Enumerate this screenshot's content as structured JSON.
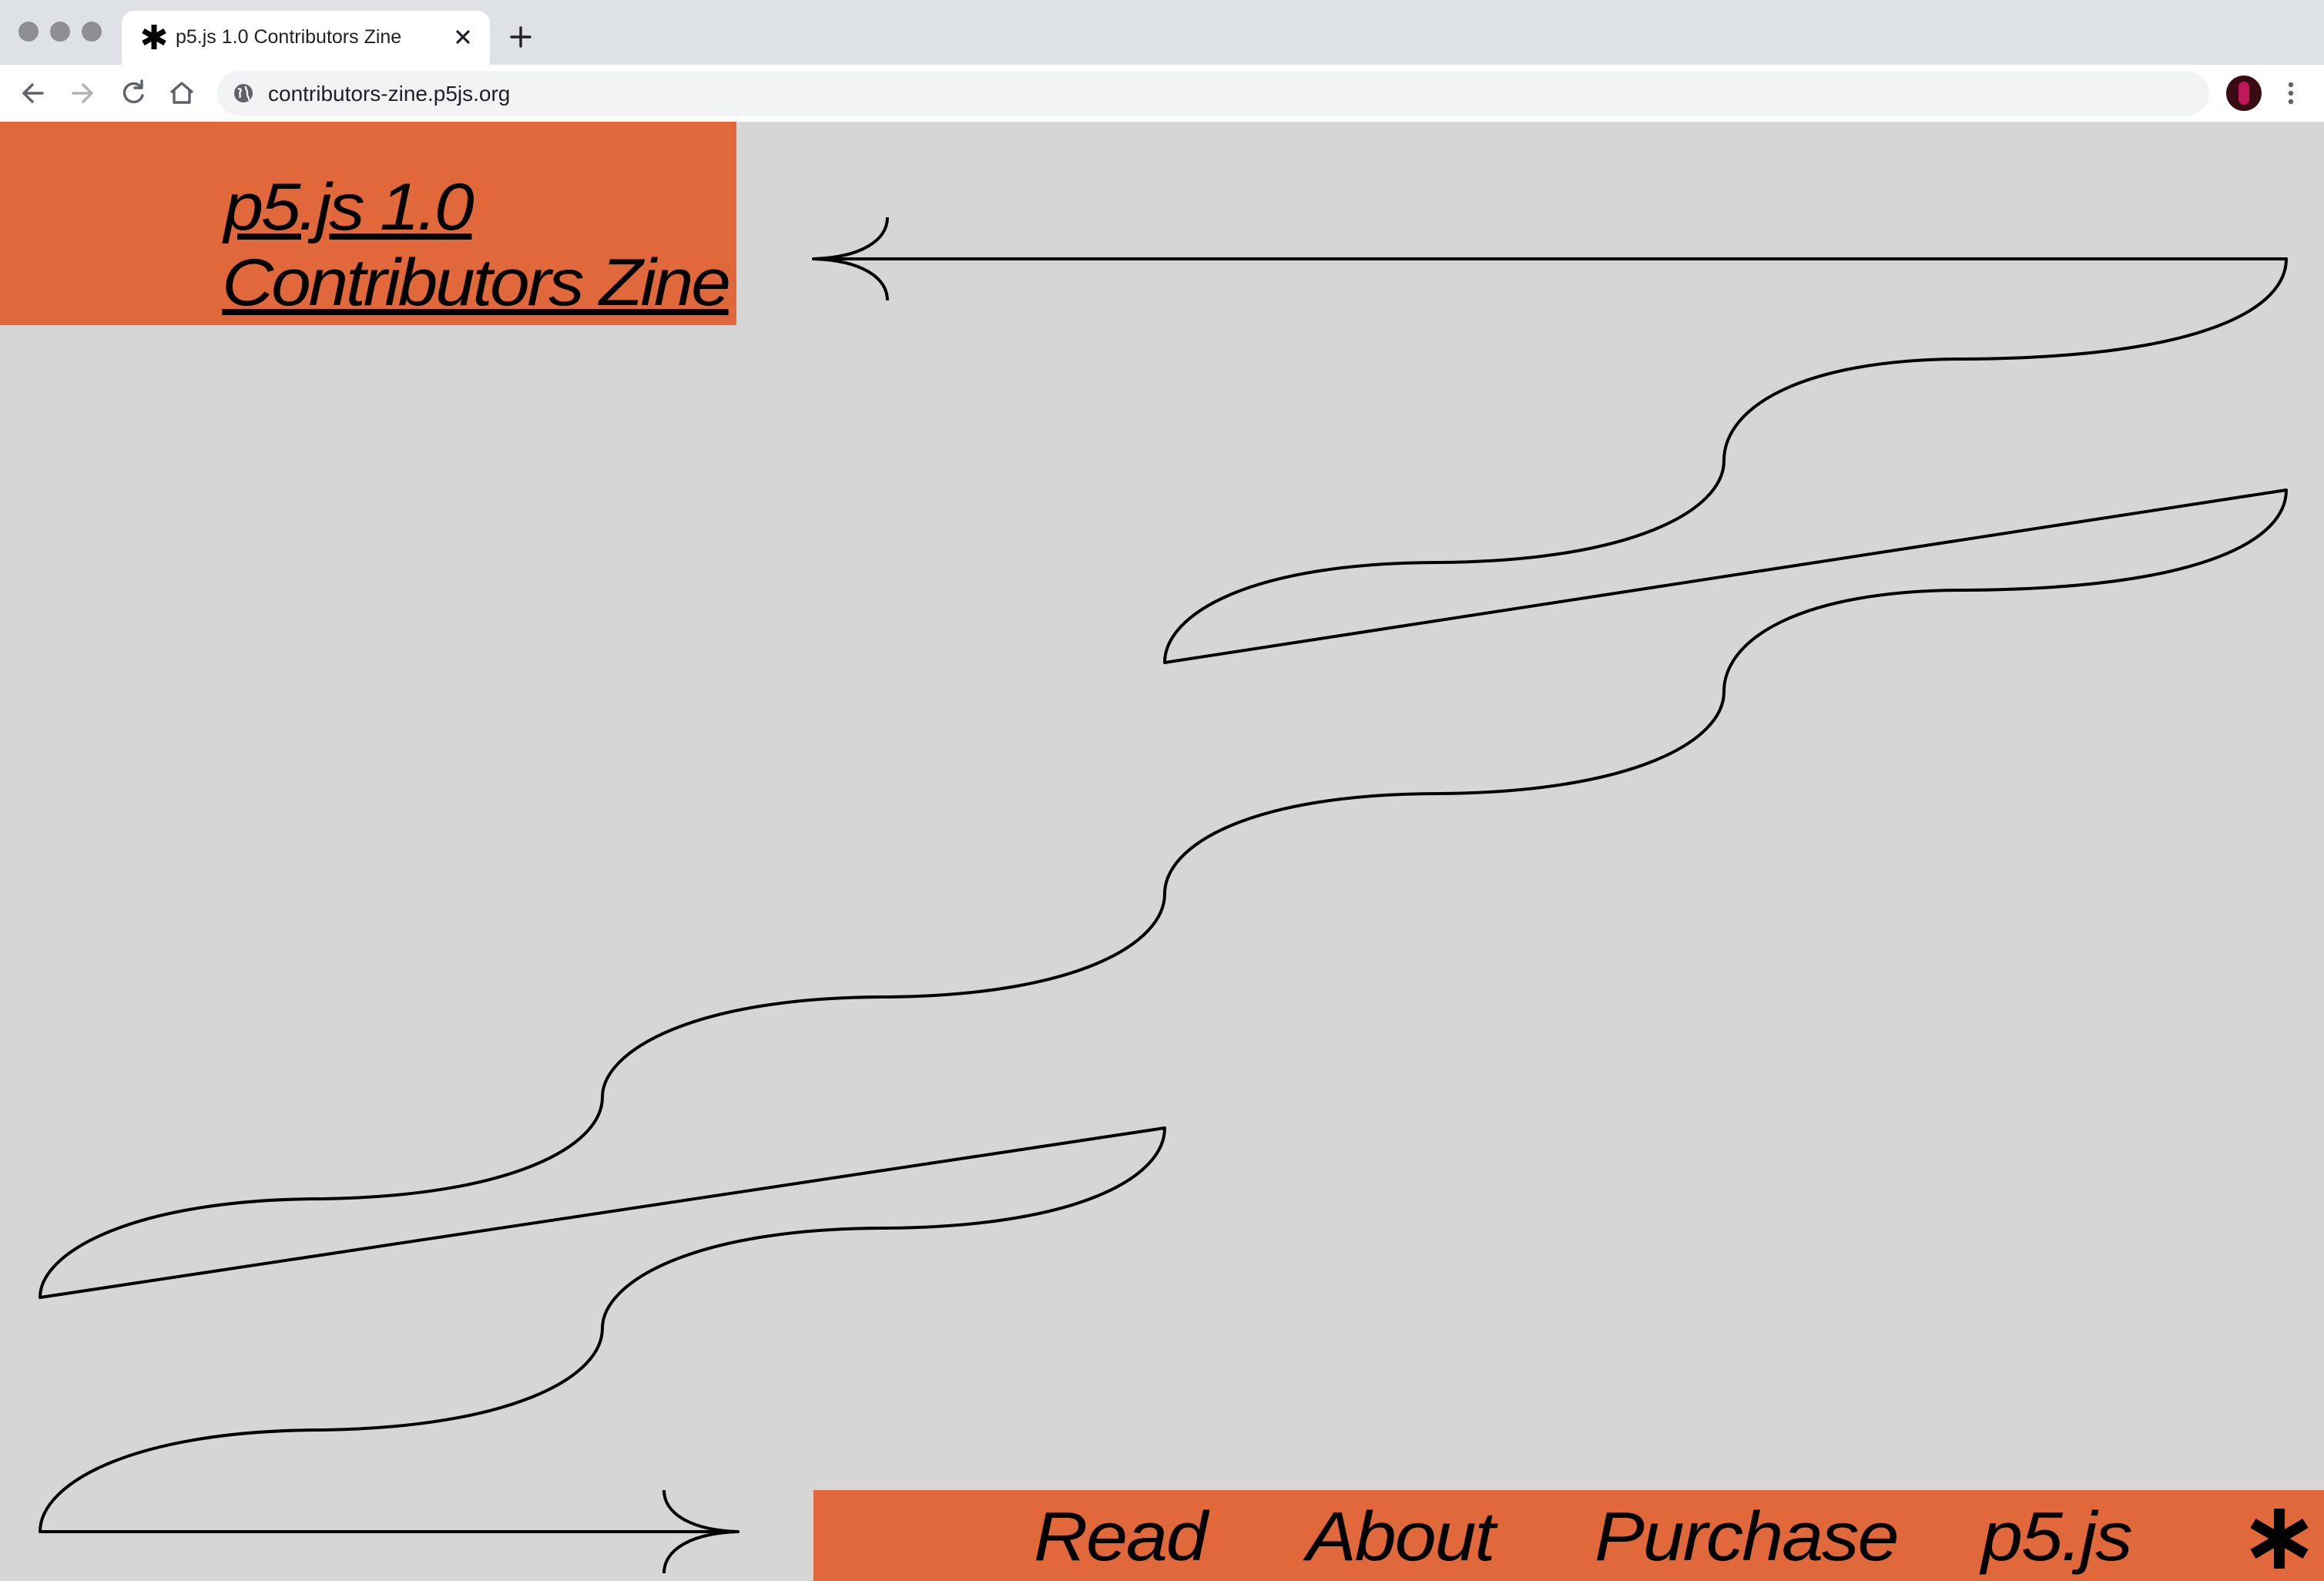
{
  "browser": {
    "tab_title": "p5.js 1.0 Contributors Zine",
    "url": "contributors-zine.p5js.org",
    "icons": {
      "window_controls": [
        "close-dot",
        "minimize-dot",
        "zoom-dot"
      ],
      "tab_favicon": "asterisk-icon",
      "tab_close": "close-icon",
      "new_tab": "plus-icon",
      "back": "arrow-left-icon",
      "forward": "arrow-right-icon",
      "reload": "reload-icon",
      "home": "home-icon",
      "site_info": "globe-icon",
      "profile": "avatar",
      "menu": "more-vertical-icon"
    }
  },
  "page": {
    "title_line_1": "p5.js 1.0",
    "title_line_2": "Contributors Zine",
    "nav": {
      "read": "Read",
      "about": "About",
      "purchase": "Purchase",
      "p5js": "p5.js",
      "star_icon": "asterisk-icon"
    },
    "colors": {
      "accent": "#e0683a",
      "background": "#d6d6d6",
      "ink": "#000000"
    }
  }
}
